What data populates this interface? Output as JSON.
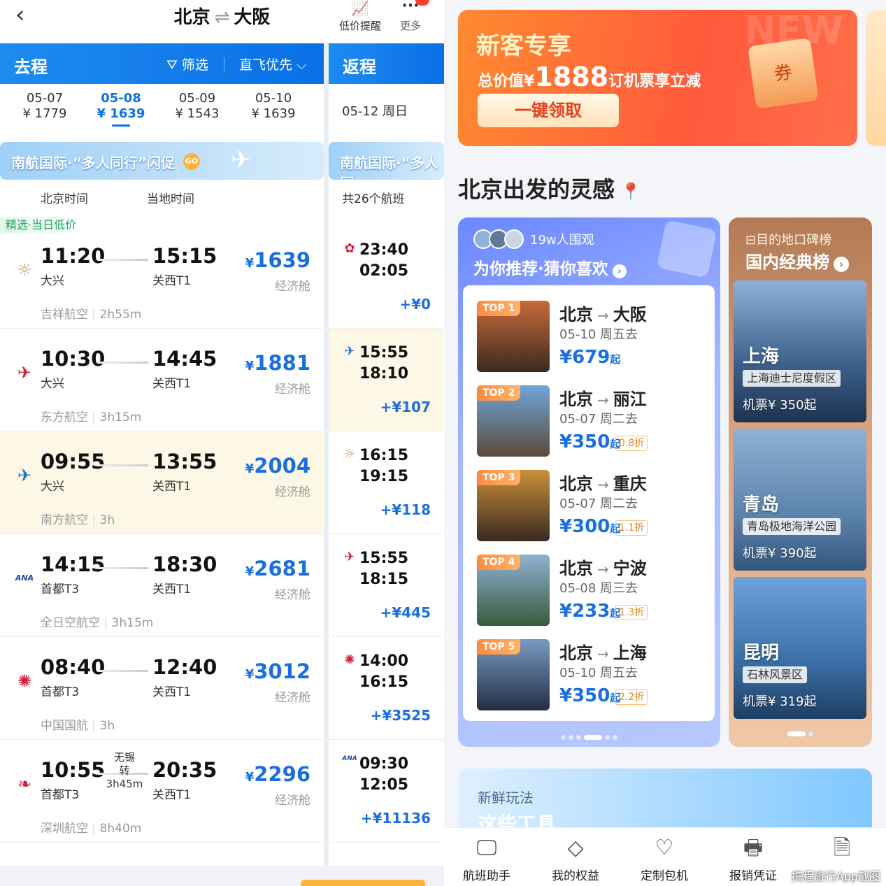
{
  "left": {
    "back_icon": "chevron-left-icon",
    "route": {
      "from": "北京",
      "arrow": "⇌",
      "to": "大阪"
    },
    "actions": [
      {
        "label": "低价提醒",
        "icon": "price-alert-icon"
      },
      {
        "label": "更多",
        "icon": "more-icon"
      }
    ],
    "outbound": {
      "title": "去程",
      "filter": "筛选",
      "sort": "直飞优先"
    },
    "return": {
      "title": "返程",
      "date": "05-12 周日",
      "count": "共26个航班"
    },
    "dates": [
      {
        "date": "05-07",
        "price": "¥ 1779",
        "selected": false
      },
      {
        "date": "05-08",
        "price": "¥ 1639",
        "selected": true
      },
      {
        "date": "05-09",
        "price": "¥ 1543",
        "selected": false
      },
      {
        "date": "05-10",
        "price": "¥ 1639",
        "selected": false
      }
    ],
    "banner": {
      "text": "南航国际·“多人同行”闪促",
      "badge": "GO",
      "text_short": "南航国际·“多人同"
    },
    "time_headers": {
      "beijing": "北京时间",
      "local": "当地时间"
    },
    "pick_tag": "精选·当日低价",
    "flights": [
      {
        "dep": "11:20",
        "dep_ap": "大兴",
        "arr": "15:15",
        "arr_ap": "关西T1",
        "price": "1639",
        "cabin": "经济舱",
        "airline": "吉祥航空",
        "duration": "2h55m",
        "logo": "juneyao-logo",
        "highlight": false
      },
      {
        "dep": "10:30",
        "dep_ap": "大兴",
        "arr": "14:45",
        "arr_ap": "关西T1",
        "price": "1881",
        "cabin": "经济舱",
        "airline": "东方航空",
        "duration": "3h15m",
        "logo": "china-eastern-logo",
        "highlight": false
      },
      {
        "dep": "09:55",
        "dep_ap": "大兴",
        "arr": "13:55",
        "arr_ap": "关西T1",
        "price": "2004",
        "cabin": "经济舱",
        "airline": "南方航空",
        "duration": "3h",
        "logo": "china-southern-logo",
        "highlight": true
      },
      {
        "dep": "14:15",
        "dep_ap": "首都T3",
        "arr": "18:30",
        "arr_ap": "关西T1",
        "price": "2681",
        "cabin": "经济舱",
        "airline": "全日空航空",
        "duration": "3h15m",
        "logo": "ana-logo",
        "highlight": false
      },
      {
        "dep": "08:40",
        "dep_ap": "首都T3",
        "arr": "12:40",
        "arr_ap": "关西T1",
        "price": "3012",
        "cabin": "经济舱",
        "airline": "中国国航",
        "duration": "3h",
        "logo": "air-china-logo",
        "highlight": false
      },
      {
        "dep": "10:55",
        "dep_ap": "首都T3",
        "arr": "20:35",
        "arr_ap": "关西T1",
        "price": "2296",
        "cabin": "经济舱",
        "airline": "深圳航空",
        "duration": "8h40m",
        "logo": "shenzhen-airlines-logo",
        "highlight": false,
        "stop": {
          "city": "无锡",
          "label": "转",
          "time": "3h45m"
        }
      }
    ],
    "return_flights": [
      {
        "dep": "23:40",
        "arr": "02:05",
        "diff": "+¥0",
        "logo": "sichuan-logo",
        "highlight": false
      },
      {
        "dep": "15:55",
        "arr": "18:10",
        "diff": "+¥107",
        "logo": "xiamen-logo",
        "highlight": true
      },
      {
        "dep": "16:15",
        "arr": "19:15",
        "diff": "+¥118",
        "logo": "juneyao-logo",
        "highlight": false
      },
      {
        "dep": "15:55",
        "arr": "18:15",
        "diff": "+¥445",
        "logo": "china-eastern-logo",
        "highlight": false
      },
      {
        "dep": "14:00",
        "arr": "16:15",
        "diff": "+¥3525",
        "logo": "air-china-logo",
        "highlight": false
      },
      {
        "dep": "09:30",
        "arr": "12:05",
        "diff": "+¥11136",
        "logo": "ana-logo",
        "highlight": false
      }
    ]
  },
  "right": {
    "promo": {
      "title": "新客专享",
      "subtitle_pre": "总价值¥",
      "subtitle_amount": "1888",
      "subtitle_post": "订机票享立减",
      "button": "一键领取",
      "coupon": "券",
      "watermark": "NEW"
    },
    "section_title": "北京出发的灵感",
    "location_icon": "location-pin-icon",
    "recommend": {
      "views": "19w人围观",
      "title": "为你推荐·猜你喜欢",
      "items": [
        {
          "rank": "TOP 1",
          "from": "北京",
          "to": "大阪",
          "date": "05-10 周五去",
          "price": "¥679",
          "unit": "起",
          "discount": ""
        },
        {
          "rank": "TOP 2",
          "from": "北京",
          "to": "丽江",
          "date": "05-07 周二去",
          "price": "¥350",
          "unit": "起",
          "discount": "0.8折"
        },
        {
          "rank": "TOP 3",
          "from": "北京",
          "to": "重庆",
          "date": "05-07 周二去",
          "price": "¥300",
          "unit": "起",
          "discount": "1.1折"
        },
        {
          "rank": "TOP 4",
          "from": "北京",
          "to": "宁波",
          "date": "05-08 周三去",
          "price": "¥233",
          "unit": "起",
          "discount": "1.3折"
        },
        {
          "rank": "TOP 5",
          "from": "北京",
          "to": "上海",
          "date": "05-10 周五去",
          "price": "¥350",
          "unit": "起",
          "discount": "2.2折"
        }
      ]
    },
    "ranking": {
      "subtitle": "目的地口碑榜",
      "title": "国内经典榜",
      "cards": [
        {
          "city": "上海",
          "tag": "上海迪士尼度假区",
          "price": "机票¥ 350起"
        },
        {
          "city": "青岛",
          "tag": "青岛极地海洋公园",
          "price": "机票¥ 390起"
        },
        {
          "city": "昆明",
          "tag": "石林风景区",
          "price": "机票¥ 319起"
        }
      ]
    },
    "fresh": {
      "title": "新鲜玩法",
      "subtitle": "这些工具"
    },
    "tabbar": [
      {
        "label": "航班助手",
        "icon": "flight-assistant-icon"
      },
      {
        "label": "我的权益",
        "icon": "benefits-icon"
      },
      {
        "label": "定制包机",
        "icon": "charter-icon"
      },
      {
        "label": "报销凭证",
        "icon": "receipt-icon"
      },
      {
        "label": "携程旅行App截图",
        "icon": "document-icon"
      }
    ]
  }
}
